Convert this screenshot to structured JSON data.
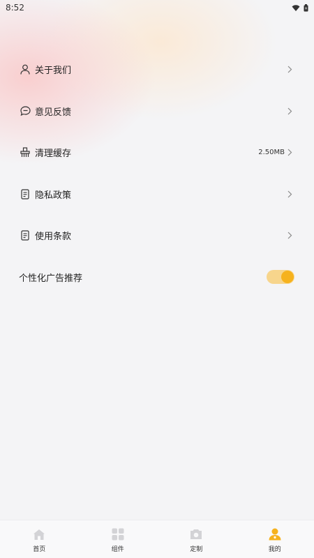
{
  "status_bar": {
    "time": "8:52"
  },
  "menu": {
    "items": [
      {
        "label": "关于我们",
        "icon": "person-icon"
      },
      {
        "label": "意见反馈",
        "icon": "chat-bubble-icon"
      },
      {
        "label": "清理缓存",
        "icon": "brush-icon",
        "value": "2.50MB"
      },
      {
        "label": "隐私政策",
        "icon": "document-icon"
      },
      {
        "label": "使用条款",
        "icon": "document-icon"
      }
    ],
    "personalized_ads": {
      "label": "个性化广告推荐",
      "enabled": true
    }
  },
  "tabbar": {
    "tabs": [
      {
        "label": "首页",
        "icon": "home-icon"
      },
      {
        "label": "组件",
        "icon": "grid-icon"
      },
      {
        "label": "定制",
        "icon": "camera-icon"
      },
      {
        "label": "我的",
        "icon": "profile-icon",
        "active": true
      }
    ]
  },
  "colors": {
    "accent": "#f6b21e",
    "toggle_track": "#f7d58c",
    "background": "#f4f4f6"
  }
}
